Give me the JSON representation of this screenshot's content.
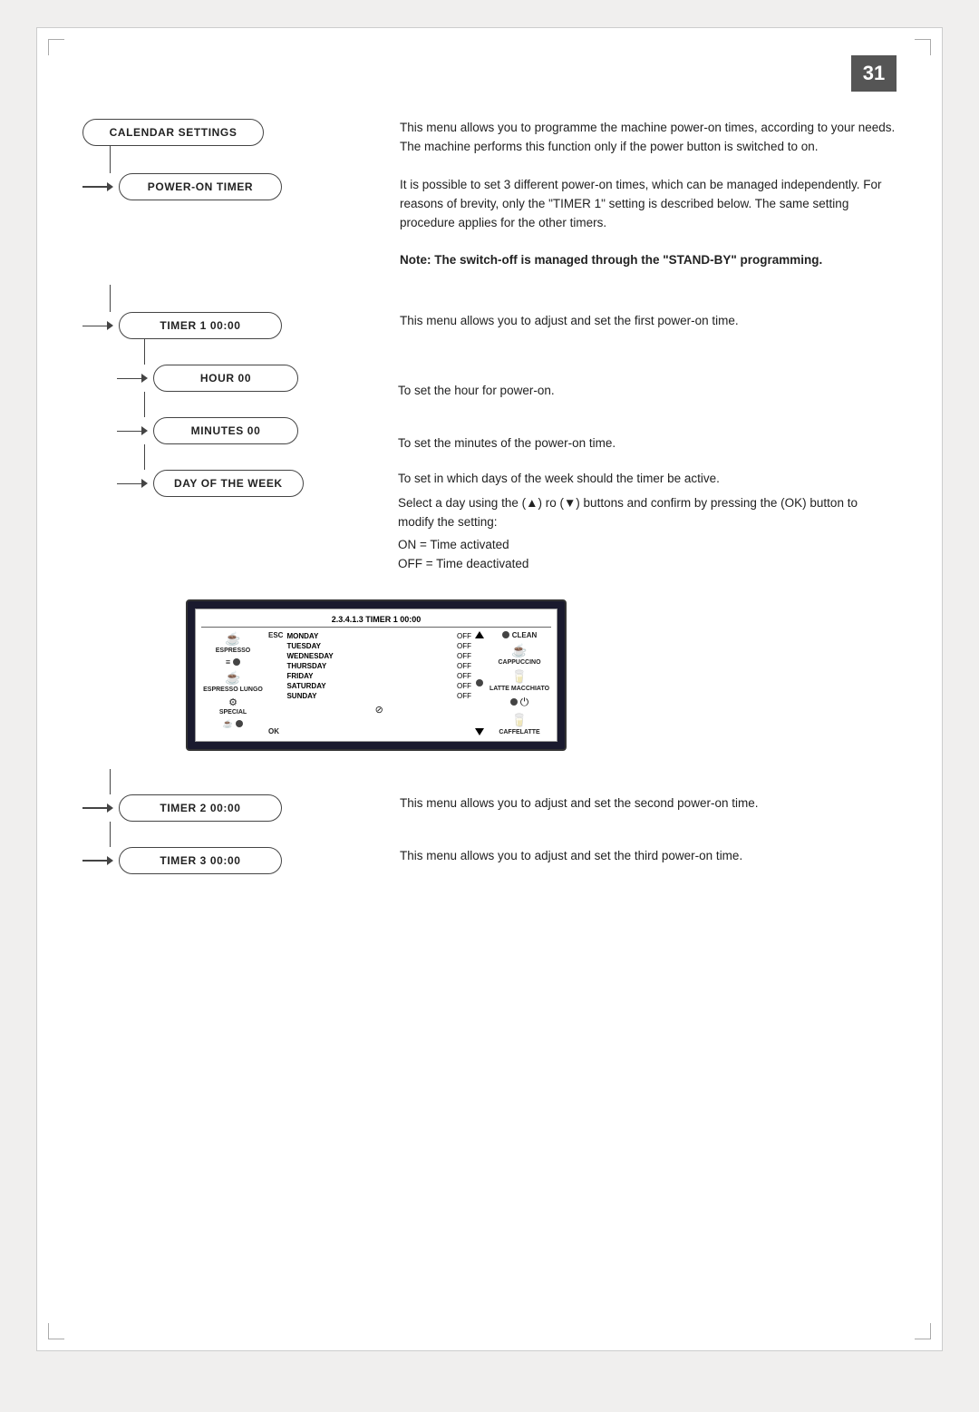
{
  "page": {
    "number": "31",
    "background": "#f0efee"
  },
  "menu": {
    "calendar_settings": "CALENDAR SETTINGS",
    "power_on_timer": "POWER-ON TIMER",
    "timer1": "TIMER 1  00:00",
    "timer2": "TIMER 2  00:00",
    "timer3": "TIMER 3  00:00",
    "hour": "HOUR 00",
    "minutes": "MINUTES 00",
    "day_of_week": "DAY OF THE WEEK"
  },
  "descriptions": {
    "power_on_timer": "This menu allows you to programme the machine power-on times, according to your needs. The machine performs this function only if the power button is switched to on.",
    "power_on_timer2": "It is possible to set 3 different power-on times, which can be managed independently. For reasons of brevity, only the \"TIMER 1\" setting is described below. The same setting procedure applies for the other timers.",
    "power_on_timer_note": "Note: The switch-off is managed through the \"STAND-BY\" programming.",
    "timer1": "This menu allows you to adjust and set the first power-on time.",
    "hour": "To set the hour for power-on.",
    "minutes": "To set the minutes of the power-on time.",
    "day_of_week_line1": "To set in which days of the week should the timer be active.",
    "day_of_week_line2": "Select a day using the (▲) ro (▼) buttons and confirm by pressing the (OK) button to modify the setting:",
    "day_of_week_on": "ON = Time activated",
    "day_of_week_off": "OFF = Time deactivated",
    "timer2": "This menu allows you to adjust and set the second power-on time.",
    "timer3": "This menu allows you to adjust and set the third power-on time."
  },
  "screen": {
    "title": "2.3.4.1.3 TIMER 1 00:00",
    "left_icons": [
      {
        "symbol": "☕",
        "label": "ESPRESSO"
      },
      {
        "symbol": "☕",
        "label": "ESPRESSO LUNGO"
      },
      {
        "symbol": "☕",
        "label": "SPECIAL"
      }
    ],
    "right_icons": [
      {
        "symbol": "☕",
        "label": "CAPPUCCINO"
      },
      {
        "symbol": "☕",
        "label": "LATTE MACCHIATO"
      },
      {
        "symbol": "☕",
        "label": "CAFFELATTE"
      }
    ],
    "days": [
      {
        "day": "MONDAY",
        "status": "OFF"
      },
      {
        "day": "TUESDAY",
        "status": "OFF"
      },
      {
        "day": "WEDNESDAY",
        "status": "OFF"
      },
      {
        "day": "THURSDAY",
        "status": "OFF"
      },
      {
        "day": "FRIDAY",
        "status": "OFF"
      },
      {
        "day": "SATURDAY",
        "status": "OFF"
      },
      {
        "day": "SUNDAY",
        "status": "OFF"
      }
    ],
    "esc_label": "ESC",
    "ok_label": "OK"
  }
}
